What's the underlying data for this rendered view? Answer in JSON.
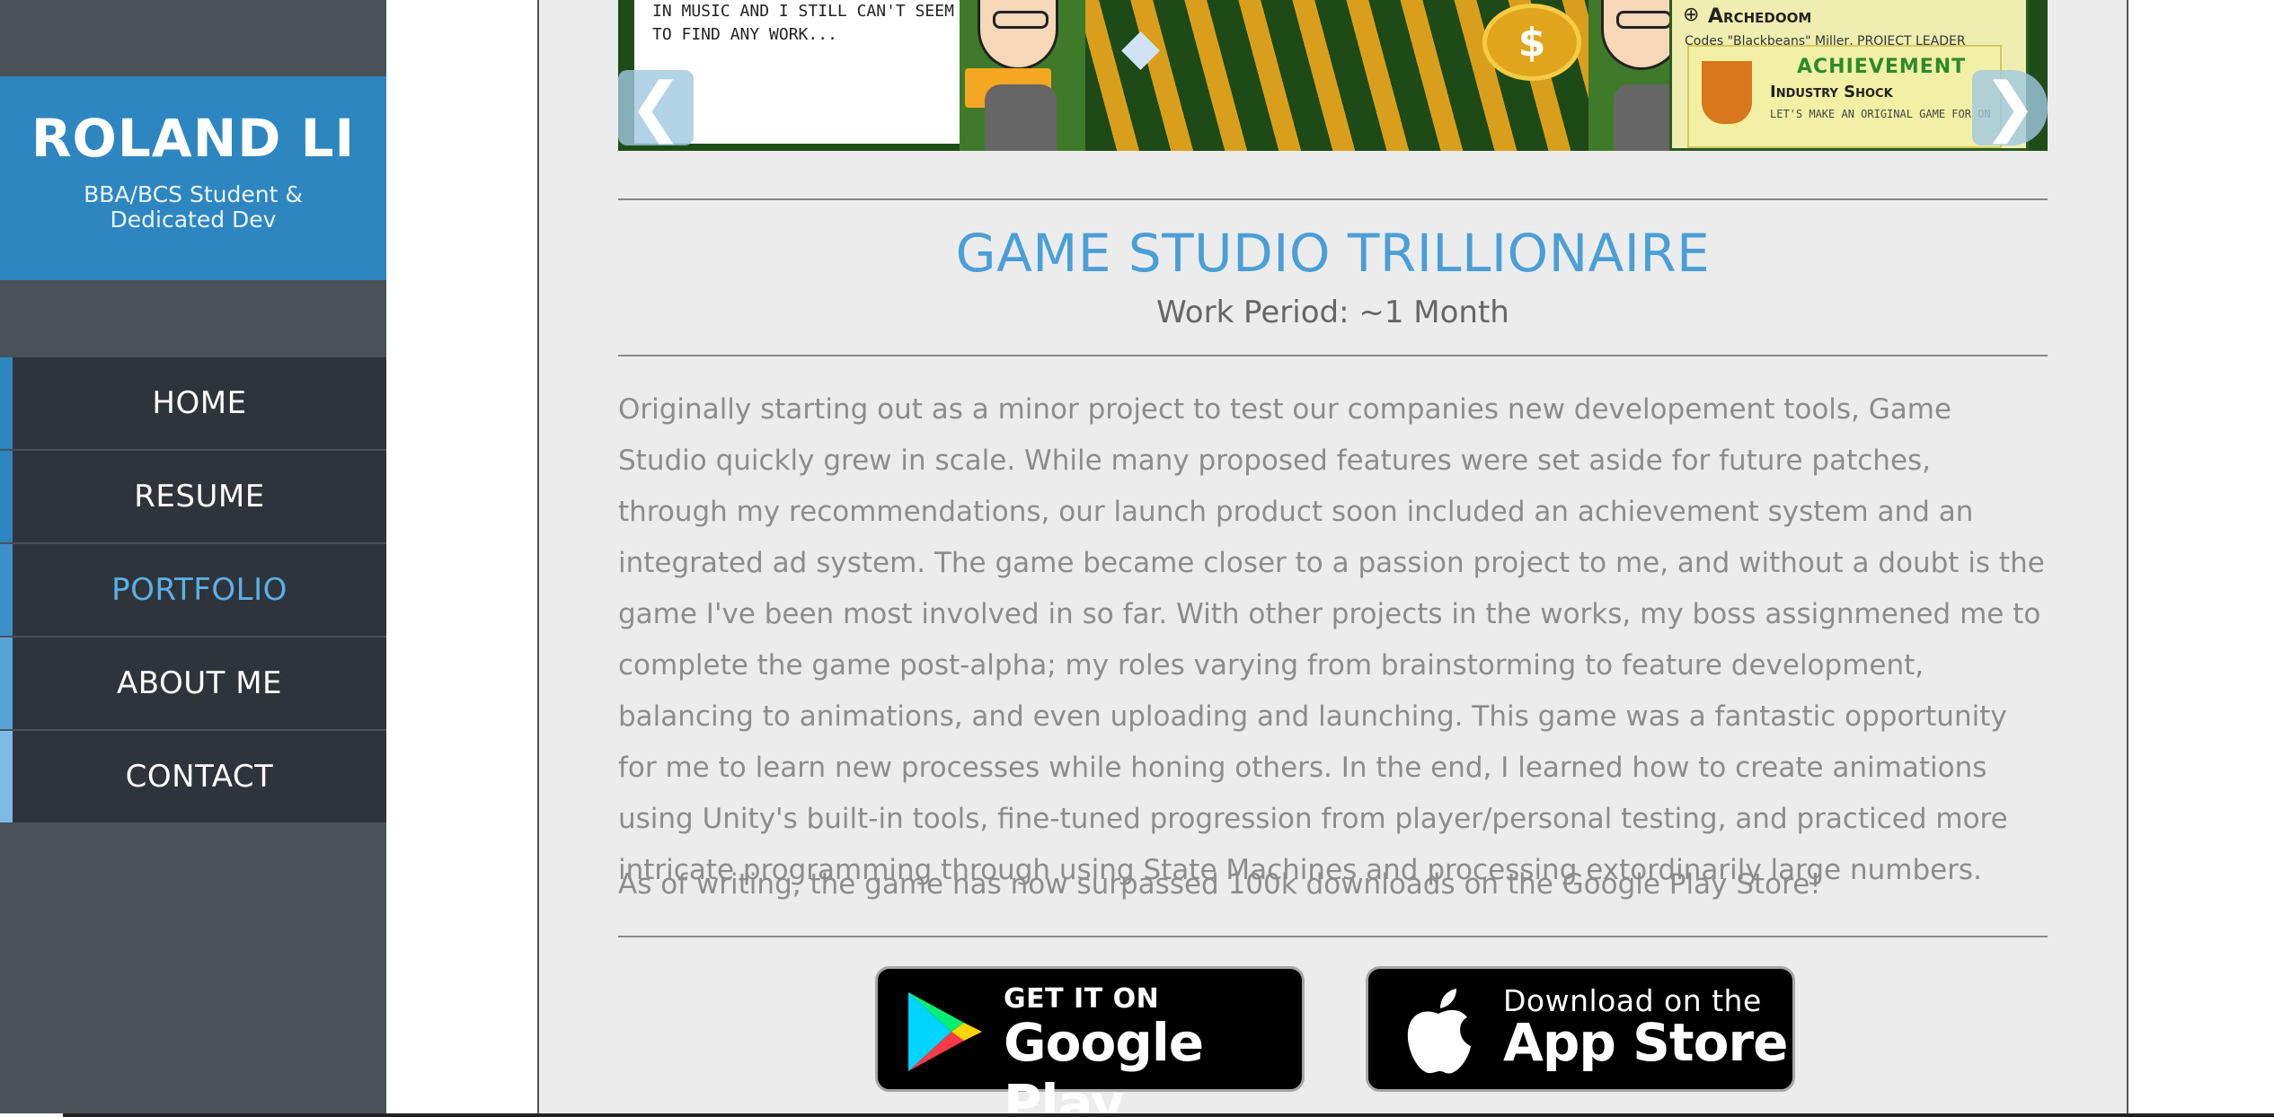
{
  "sidebar": {
    "brand_name": "ROLAND LI",
    "brand_subtitle": "BBA/BCS Student & Dedicated Dev",
    "nav": [
      {
        "label": "HOME",
        "active": false
      },
      {
        "label": "RESUME",
        "active": false
      },
      {
        "label": "PORTFOLIO",
        "active": true
      },
      {
        "label": "ABOUT ME",
        "active": false
      },
      {
        "label": "CONTACT",
        "active": false
      }
    ]
  },
  "banner": {
    "dialog_text": "IN MUSIC AND I STILL CAN'T SEEM TO FIND ANY WORK...",
    "panel_title": "Archedoom",
    "panel_sub": "Codes \"Blackbeans\" Miller, PROJECT LEADER",
    "achievement_title": "ACHIEVEMENT",
    "achievement_name": "Industry Shock",
    "achievement_desc": "LET'S MAKE AN ORIGINAL GAME FOR ON",
    "prev_arrow": "arrow-left-icon",
    "next_arrow": "arrow-right-icon"
  },
  "project": {
    "title": "GAME STUDIO TRILLIONAIRE",
    "work_period": "Work Period: ~1 Month",
    "description": "Originally starting out as a minor project to test our companies new developement tools, Game Studio quickly grew in scale. While many proposed features were set aside for future patches, through my recommendations, our launch product soon included an achievement system and an integrated ad system. The game became closer to a passion project to me, and without a doubt is the game I've been most involved in so far. With other projects in the works, my boss assignmened me to complete the game post-alpha; my roles varying from brainstorming to feature development, balancing to animations, and even uploading and launching. This game was a fantastic opportunity for me to learn new processes while honing others. In the end, I learned how to create animations using Unity's built-in tools, fine-tuned progression from player/personal testing, and practiced more intricate programming through using State Machines and processing extordinarily large numbers.",
    "note": "As of writing, the game has now surpassed 100k downloads on the Google Play Store!"
  },
  "stores": {
    "google_top": "GET IT ON",
    "google_big": "Google Play",
    "apple_top": "Download on the",
    "apple_big": "App Store"
  },
  "colors": {
    "brand": "#2e86c1",
    "sidebar_bg": "#4a5157",
    "nav_bg": "#2f343a",
    "active_nav": "#5ab0e8",
    "title": "#4a9fd6",
    "body_text": "#8c8c8c"
  }
}
